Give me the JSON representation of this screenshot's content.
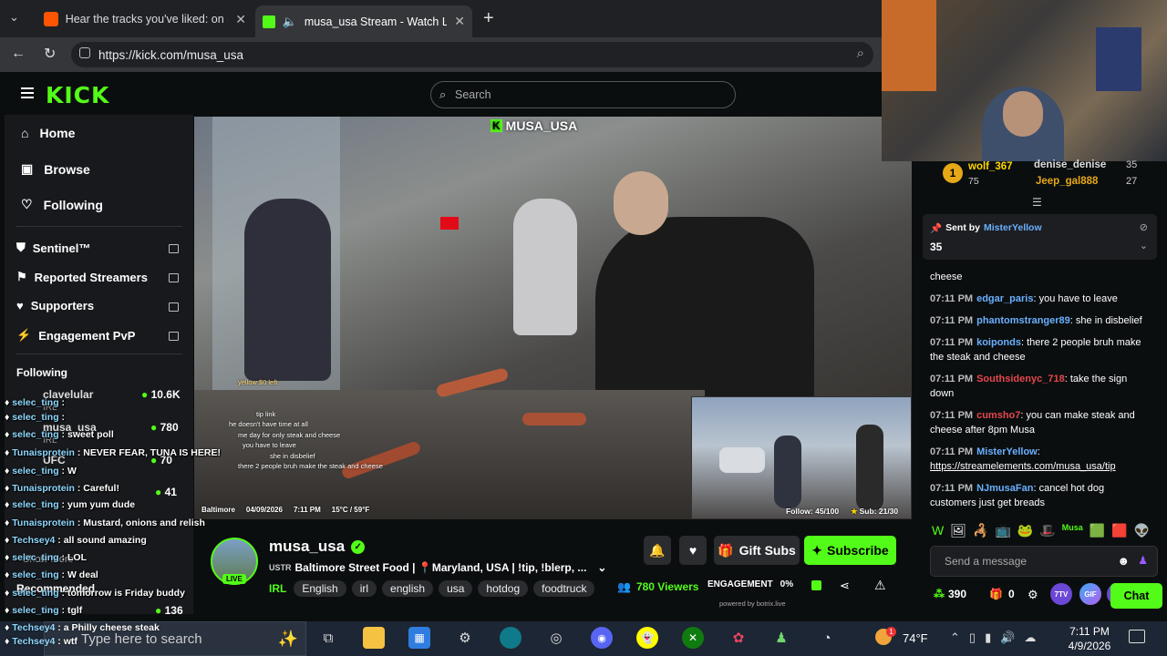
{
  "browser": {
    "tabs": [
      {
        "title": "Hear the tracks you've liked: on Sc"
      },
      {
        "title": "musa_usa Stream - Watch Liv"
      }
    ],
    "url": "https://kick.com/musa_usa"
  },
  "kick": {
    "logo": "KICK",
    "search_placeholder": "Search",
    "nav": [
      {
        "label": "Home",
        "icon": "home-icon"
      },
      {
        "label": "Browse",
        "icon": "browse-icon"
      },
      {
        "label": "Following",
        "icon": "heart-icon"
      }
    ],
    "nav_external": [
      {
        "label": "Sentinel™",
        "icon": "shield-icon"
      },
      {
        "label": "Reported Streamers",
        "icon": "flag-icon"
      },
      {
        "label": "Supporters",
        "icon": "heart-icon"
      },
      {
        "label": "Engagement PvP",
        "icon": "bolt-icon"
      }
    ],
    "following_heading": "Following",
    "following": [
      {
        "name": "clavelular",
        "sub": "IRL",
        "count": "10.6K"
      },
      {
        "name": "musa_usa",
        "sub": "IRL",
        "count": "780"
      },
      {
        "name": "UFC",
        "sub": "",
        "count": "70"
      },
      {
        "name": "",
        "sub": "",
        "count": "41"
      },
      {
        "name": "",
        "sub": "",
        "count": "136"
      }
    ],
    "show_more": "Show More",
    "recommended_heading": "Recommended"
  },
  "video": {
    "watermark": "MUSA_USA",
    "overlay_location": "Baltimore",
    "overlay_date": "04/09/2026",
    "overlay_time": "7:11 PM",
    "overlay_weather": "15°C / 59°F",
    "follow_goal": "Follow: 45/100",
    "sub_goal": "Sub: 21/30",
    "video_chat": [
      "yellow $0 left",
      "tip link",
      "he doesn't have time at all",
      "me day for only steak and cheese",
      "you have to leave",
      "she in disbelief",
      "there 2 people bruh make the steak and cheese"
    ]
  },
  "overlay_chat": [
    {
      "user": "selec_ting",
      "msg": ""
    },
    {
      "user": "selec_ting",
      "msg": ""
    },
    {
      "user": "selec_ting",
      "msg": "sweet poll"
    },
    {
      "user": "Tunaisprotein",
      "msg": "NEVER FEAR, TUNA IS HERE!"
    },
    {
      "user": "selec_ting",
      "msg": "W"
    },
    {
      "user": "Tunaisprotein",
      "msg": "Careful!"
    },
    {
      "user": "selec_ting",
      "msg": "yum yum dude"
    },
    {
      "user": "Tunaisprotein",
      "msg": "Mustard, onions and relish"
    },
    {
      "user": "Techsey4",
      "msg": "all sound amazing"
    },
    {
      "user": "selec_ting",
      "msg": "LOL"
    },
    {
      "user": "selec_ting",
      "msg": "W deal"
    },
    {
      "user": "selec_ting",
      "msg": "tomorrow is Friday buddy"
    },
    {
      "user": "selec_ting",
      "msg": "tglf"
    },
    {
      "user": "Techsey4",
      "msg": "a Philly cheese steak"
    },
    {
      "user": "Techsey4",
      "msg": "wtf"
    }
  ],
  "stream": {
    "channel": "musa_usa",
    "title_prefix": "USTR",
    "title": "Baltimore Street Food | 📍Maryland, USA | !tip, !blerp, ...",
    "live_badge": "LIVE",
    "category": "IRL",
    "tags": [
      "English",
      "irl",
      "english",
      "usa",
      "hotdog",
      "foodtruck"
    ],
    "gift_subs": "Gift Subs",
    "subscribe": "Subscribe",
    "viewers": "780 Viewers",
    "engagement_label": "ENGAGEMENT",
    "engagement_value": "0%",
    "powered_by": "powered by botrix.live"
  },
  "chat": {
    "top_gifters": [
      {
        "name": "wolf_367",
        "count": "75"
      },
      {
        "name": "denise_denise",
        "count": "35"
      },
      {
        "name": "Jeep_gal888",
        "count": "27"
      }
    ],
    "pinned_by_label": "Sent by",
    "pinned_by_user": "MisterYellow",
    "pinned_value": "35",
    "messages": [
      {
        "time": "",
        "user": "",
        "text": "cheese",
        "color": "#ffffff"
      },
      {
        "time": "07:11 PM",
        "user": "edgar_paris",
        "text": "you have to leave",
        "color": "#6ab0ff"
      },
      {
        "time": "07:11 PM",
        "user": "phantomstranger89",
        "text": "she in disbelief",
        "color": "#6ab0ff"
      },
      {
        "time": "07:11 PM",
        "user": "koiponds",
        "text": "there 2 people bruh make the steak and cheese",
        "color": "#6ab0ff"
      },
      {
        "time": "07:11 PM",
        "user": "Southsidenyc_718",
        "text": "take the sign down",
        "color": "#e5484d"
      },
      {
        "time": "07:11 PM",
        "user": "cumsho7",
        "text": "you can make steak and cheese after 8pm Musa",
        "color": "#e5484d"
      },
      {
        "time": "07:11 PM",
        "user": "MisterYellow",
        "text": "https://streamelements.com/musa_usa/tip",
        "color": "#6ab0ff"
      },
      {
        "time": "07:11 PM",
        "user": "NJmusaFan",
        "text": "cancel hot dog customers just get breads",
        "color": "#6ab0ff"
      }
    ],
    "input_placeholder": "Send a message",
    "points": "390",
    "gift_count": "0",
    "chat_button": "Chat",
    "emote_labels": [
      "7TV",
      "GIF"
    ]
  },
  "taskbar": {
    "search_placeholder": "Type here to search",
    "weather": "74°F",
    "time": "7:11 PM",
    "date": "4/9/2026",
    "notification_count": "1"
  }
}
